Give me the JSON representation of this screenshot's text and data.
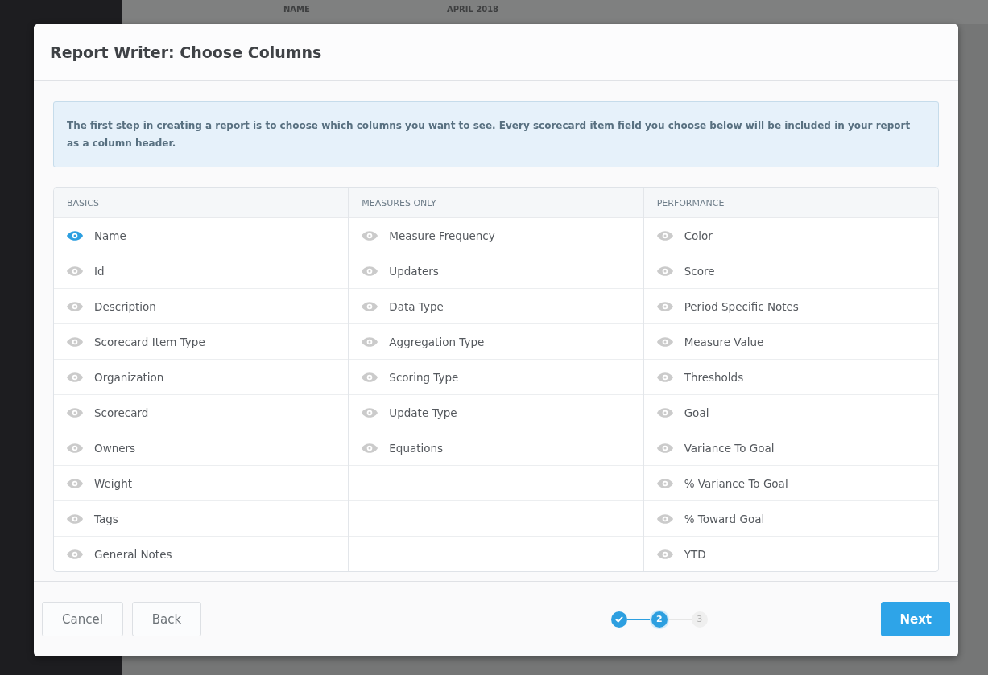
{
  "background": {
    "columns": [
      "NAME",
      "APRIL 2018"
    ]
  },
  "dialog": {
    "title": "Report Writer: Choose Columns",
    "info": "The first step in creating a report is to choose which columns you want to see. Every scorecard item field you choose below will be included in your report as a column header.",
    "groups": [
      {
        "heading": "BASICS",
        "items": [
          {
            "label": "Name",
            "selected": true
          },
          {
            "label": "Id",
            "selected": false
          },
          {
            "label": "Description",
            "selected": false
          },
          {
            "label": "Scorecard Item Type",
            "selected": false
          },
          {
            "label": "Organization",
            "selected": false
          },
          {
            "label": "Scorecard",
            "selected": false
          },
          {
            "label": "Owners",
            "selected": false
          },
          {
            "label": "Weight",
            "selected": false
          },
          {
            "label": "Tags",
            "selected": false
          },
          {
            "label": "General Notes",
            "selected": false
          }
        ]
      },
      {
        "heading": "MEASURES ONLY",
        "items": [
          {
            "label": "Measure Frequency",
            "selected": false
          },
          {
            "label": "Updaters",
            "selected": false
          },
          {
            "label": "Data Type",
            "selected": false
          },
          {
            "label": "Aggregation Type",
            "selected": false
          },
          {
            "label": "Scoring Type",
            "selected": false
          },
          {
            "label": "Update Type",
            "selected": false
          },
          {
            "label": "Equations",
            "selected": false
          }
        ]
      },
      {
        "heading": "PERFORMANCE",
        "items": [
          {
            "label": "Color",
            "selected": false
          },
          {
            "label": "Score",
            "selected": false
          },
          {
            "label": "Period Specific Notes",
            "selected": false
          },
          {
            "label": "Measure Value",
            "selected": false
          },
          {
            "label": "Thresholds",
            "selected": false
          },
          {
            "label": "Goal",
            "selected": false
          },
          {
            "label": "Variance To Goal",
            "selected": false
          },
          {
            "label": "% Variance To Goal",
            "selected": false
          },
          {
            "label": "% Toward Goal",
            "selected": false
          },
          {
            "label": "YTD",
            "selected": false
          }
        ]
      }
    ],
    "buttons_left": [
      "Cancel",
      "Back"
    ],
    "steps": [
      {
        "done": true,
        "current": false
      },
      {
        "label": "2",
        "done": false,
        "current": true
      },
      {
        "label": "3",
        "done": false,
        "current": false
      }
    ],
    "next_button": "Next"
  }
}
